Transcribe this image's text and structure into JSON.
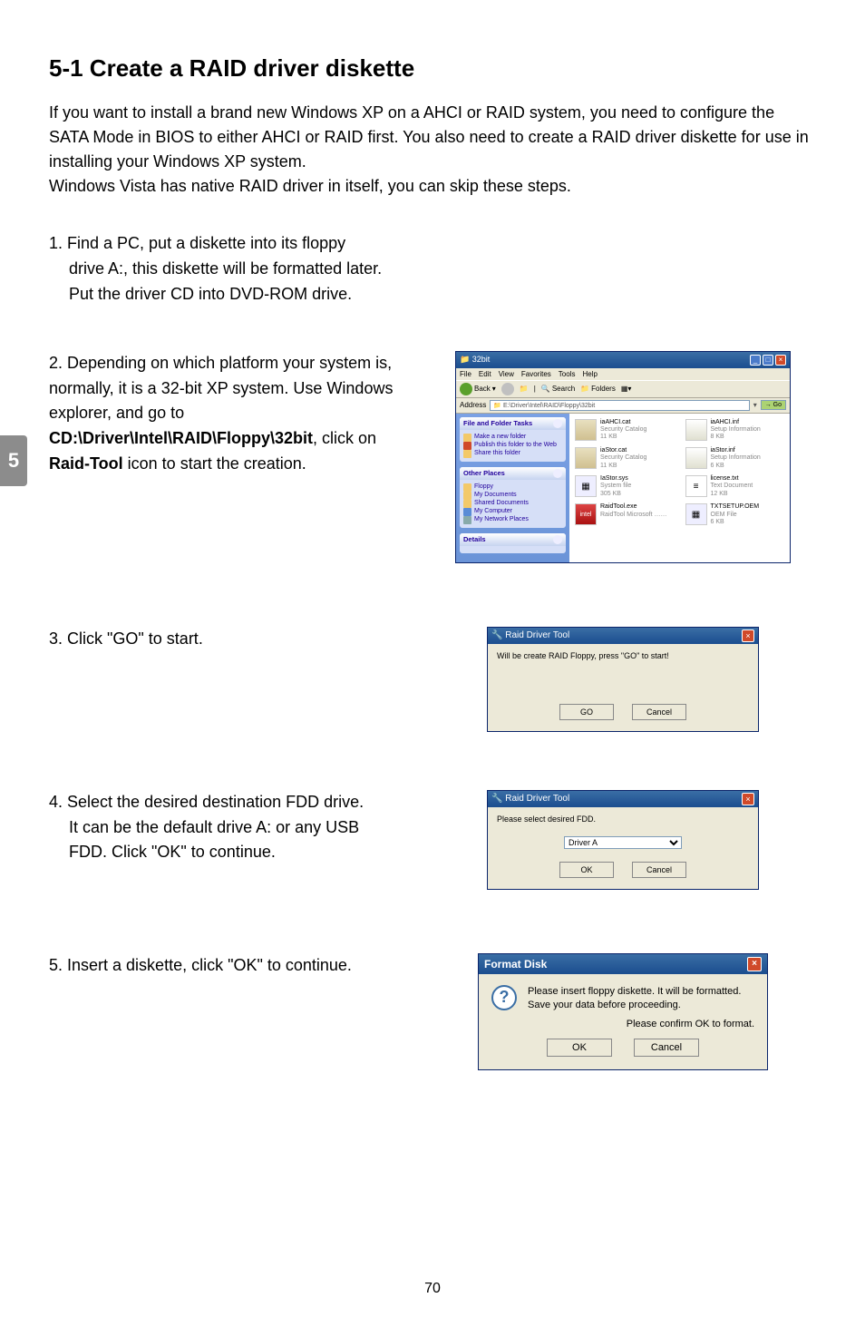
{
  "sideTab": "5",
  "heading": "5-1 Create a RAID driver diskette",
  "intro": "If you want to install a brand new Windows XP on a AHCI or RAID system, you need to configure the SATA Mode in BIOS to either AHCI or RAID first. You also need to create a RAID driver diskette for use in installing your Windows XP system.\nWindows Vista has native RAID driver in itself, you can skip these steps.",
  "steps": {
    "s1": {
      "num": "1. Find a PC, put a diskette into its floppy",
      "line2": "drive A:, this diskette will be formatted later.",
      "line3": "Put the driver CD into DVD-ROM drive."
    },
    "s2": {
      "pre": "2. Depending on which platform your system is, normally, it is a 32-bit XP system. Use Windows explorer, and go to ",
      "bold1": "CD:\\Driver\\Intel\\RAID\\Floppy\\32bit",
      "mid": ", click on ",
      "bold2": "Raid-Tool",
      "post": " icon to start the creation."
    },
    "s3": "3. Click \"GO\" to start.",
    "s4": {
      "num": "4. Select the desired destination FDD drive.",
      "line2": "It can be the default drive A: or any USB",
      "line3": "FDD. Click \"OK\" to continue."
    },
    "s5": "5. Insert a diskette, click \"OK\" to continue."
  },
  "explorer": {
    "title": "32bit",
    "menus": [
      "File",
      "Edit",
      "View",
      "Favorites",
      "Tools",
      "Help"
    ],
    "toolbar": {
      "back": "Back",
      "search": "Search",
      "folders": "Folders"
    },
    "addressLabel": "Address",
    "address": "E:\\Driver\\Intel\\RAID\\Floppy\\32bit",
    "go": "Go",
    "panels": {
      "tasks": {
        "title": "File and Folder Tasks",
        "items": [
          "Make a new folder",
          "Publish this folder to the Web",
          "Share this folder"
        ]
      },
      "places": {
        "title": "Other Places",
        "items": [
          "Floppy",
          "My Documents",
          "Shared Documents",
          "My Computer",
          "My Network Places"
        ]
      },
      "details": {
        "title": "Details"
      }
    },
    "files": [
      {
        "name": "iaAHCI.cat",
        "desc": "Security Catalog",
        "size": "11 KB",
        "icon": "cat"
      },
      {
        "name": "iaAHCI.inf",
        "desc": "Setup Information",
        "size": "8 KB",
        "icon": "inf"
      },
      {
        "name": "iaStor.cat",
        "desc": "Security Catalog",
        "size": "11 KB",
        "icon": "cat"
      },
      {
        "name": "iaStor.inf",
        "desc": "Setup Information",
        "size": "6 KB",
        "icon": "inf"
      },
      {
        "name": "IaStor.sys",
        "desc": "System file",
        "size": "305 KB",
        "icon": "sys"
      },
      {
        "name": "license.txt",
        "desc": "Text Document",
        "size": "12 KB",
        "icon": "txt"
      },
      {
        "name": "RaidTool.exe",
        "desc": "RaidTool Microsoft ……",
        "size": "",
        "icon": "exe"
      },
      {
        "name": "TXTSETUP.OEM",
        "desc": "OEM File",
        "size": "6 KB",
        "icon": "sys"
      }
    ]
  },
  "raidTool1": {
    "title": "Raid Driver Tool",
    "note": "Will be create RAID Floppy, press \"GO\" to start!",
    "go": "GO",
    "cancel": "Cancel"
  },
  "raidTool2": {
    "title": "Raid Driver Tool",
    "note": "Please select desired FDD.",
    "option": "Driver A",
    "ok": "OK",
    "cancel": "Cancel"
  },
  "formatDisk": {
    "title": "Format Disk",
    "line1": "Please insert floppy diskette.  It will be formatted.",
    "line2": "Save your data before proceeding.",
    "confirm": "Please confirm OK to format.",
    "ok": "OK",
    "cancel": "Cancel"
  },
  "pageNumber": "70"
}
